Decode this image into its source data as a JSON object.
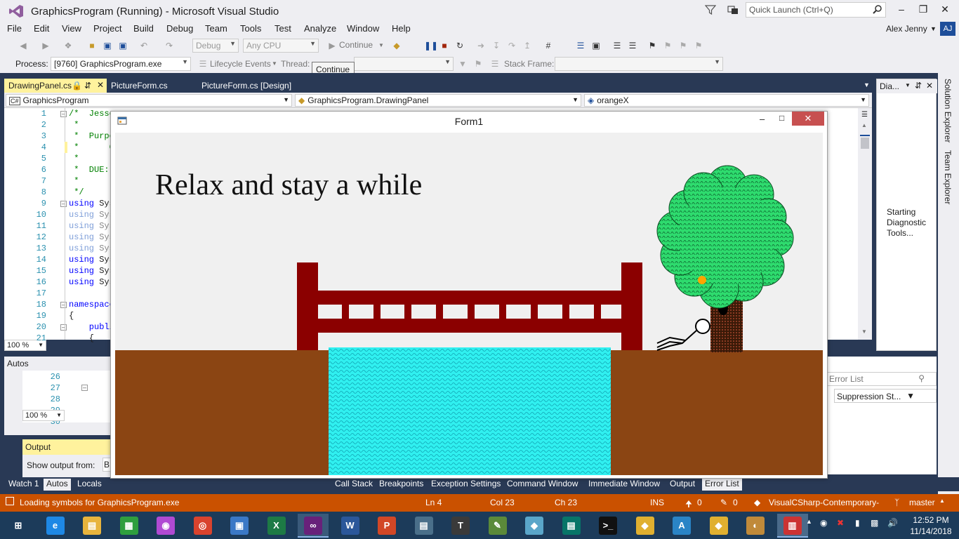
{
  "window": {
    "title": "GraphicsProgram (Running) - Microsoft Visual Studio",
    "quick_launch_placeholder": "Quick Launch (Ctrl+Q)",
    "user_name": "Alex Jenny",
    "user_initials": "AJ"
  },
  "menu": [
    "File",
    "Edit",
    "View",
    "Project",
    "Build",
    "Debug",
    "Team",
    "Tools",
    "Test",
    "Analyze",
    "Window",
    "Help"
  ],
  "toolbar": {
    "config": "Debug",
    "platform": "Any CPU",
    "continue_label": "Continue",
    "process_label": "Process:",
    "process_value": "[9760] GraphicsProgram.exe",
    "lifecycle_label": "Lifecycle Events",
    "thread_label": "Thread:",
    "stack_frame_label": "Stack Frame:",
    "tooltip": "Continue"
  },
  "tabs": [
    {
      "label": "DrawingPanel.cs",
      "active": true
    },
    {
      "label": "PictureForm.cs",
      "active": false
    },
    {
      "label": "PictureForm.cs [Design]",
      "active": false
    }
  ],
  "navbar": {
    "project": "GraphicsProgram",
    "type": "GraphicsProgram.DrawingPanel",
    "member": "orangeX"
  },
  "code": {
    "line_numbers": [
      "1",
      "2",
      "3",
      "4",
      "5",
      "6",
      "7",
      "8",
      "9",
      "10",
      "11",
      "12",
      "13",
      "14",
      "15",
      "16",
      "17",
      "18",
      "19",
      "20",
      "21"
    ],
    "lines": [
      {
        "text": "/*  Jesse",
        "kind": "comment"
      },
      {
        "text": " *",
        "kind": "comment"
      },
      {
        "text": " *  Purpo",
        "kind": "comment"
      },
      {
        "text": " *      C",
        "kind": "comment"
      },
      {
        "text": " *",
        "kind": "comment"
      },
      {
        "text": " *  DUE:",
        "kind": "comment"
      },
      {
        "text": " *",
        "kind": "comment"
      },
      {
        "text": " */",
        "kind": "comment"
      },
      {
        "kw": "using",
        "text": " Sys",
        "kind": "using"
      },
      {
        "kw": "using",
        "text": " Sys",
        "kind": "using-dim"
      },
      {
        "kw": "using",
        "text": " Sys",
        "kind": "using-dim"
      },
      {
        "kw": "using",
        "text": " Sys",
        "kind": "using-dim"
      },
      {
        "kw": "using",
        "text": " Sys",
        "kind": "using-dim"
      },
      {
        "kw": "using",
        "text": " Sys",
        "kind": "using"
      },
      {
        "kw": "using",
        "text": " Sys",
        "kind": "using"
      },
      {
        "kw": "using",
        "text": " Sys",
        "kind": "using"
      },
      {
        "text": "",
        "kind": "plain"
      },
      {
        "kw": "namespace",
        "text": "",
        "kind": "using"
      },
      {
        "text": "{",
        "kind": "plain"
      },
      {
        "kw": "    publi",
        "text": "",
        "kind": "using"
      },
      {
        "text": "    {",
        "kind": "plain"
      }
    ],
    "zoom": "100 %"
  },
  "diagnostics": {
    "title": "Dia...",
    "status": "Starting Diagnostic Tools..."
  },
  "side_tabs": [
    "Solution Explorer",
    "Team Explorer"
  ],
  "autos": {
    "title": "Autos",
    "line_numbers": [
      "26",
      "27",
      "28",
      "29",
      "30"
    ],
    "zoom": "100 %"
  },
  "output": {
    "title": "Output",
    "show_from_label": "Show output from:",
    "show_from_value": "B"
  },
  "error_list": {
    "search_placeholder": "Error List",
    "column": "Suppression St..."
  },
  "bottom_tabs_left": [
    {
      "label": "Watch 1",
      "active": false
    },
    {
      "label": "Autos",
      "active": true
    },
    {
      "label": "Locals",
      "active": false
    }
  ],
  "bottom_tabs_right": [
    {
      "label": "Call Stack",
      "active": false
    },
    {
      "label": "Breakpoints",
      "active": false
    },
    {
      "label": "Exception Settings",
      "active": false
    },
    {
      "label": "Command Window",
      "active": false
    },
    {
      "label": "Immediate Window",
      "active": false
    },
    {
      "label": "Output",
      "active": false
    },
    {
      "label": "Error List",
      "active": true
    }
  ],
  "status": {
    "message": "Loading symbols for GraphicsProgram.exe",
    "ln": "Ln 4",
    "col": "Col 23",
    "ch": "Ch 23",
    "mode": "INS",
    "up_count": "0",
    "pencil_count": "0",
    "repo": "VisualCSharp-Contemporary-",
    "branch": "master"
  },
  "taskbar": {
    "time": "12:52 PM",
    "date": "11/14/2018",
    "apps": [
      "start",
      "ie",
      "explorer",
      "store",
      "picasa",
      "chrome",
      "remote",
      "excel",
      "visualstudio",
      "word",
      "powerpoint",
      "reader",
      "typora",
      "notepad",
      "paint3d",
      "publisher",
      "cmd",
      "git",
      "atom",
      "sourcetree",
      "paint",
      "gallery"
    ]
  },
  "form": {
    "title": "Form1",
    "caption": "Relax and stay a while"
  },
  "colors": {
    "accent_yellow": "#fff29d",
    "dark_band": "#293955",
    "status_orange": "#ca5100",
    "bridge": "#8b0000",
    "ground": "#8b4513",
    "water": "#2ee8e8",
    "leaves": "#2bd46a",
    "trunk": "#5a2d0c",
    "orange_fruit": "#ffa500"
  }
}
